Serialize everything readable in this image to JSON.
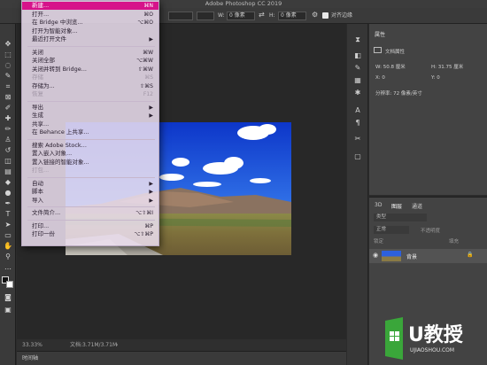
{
  "app": {
    "title": "Adobe Photoshop CC 2019"
  },
  "options_bar": {
    "w_label": "W:",
    "w_value": "0 像素",
    "h_label": "H:",
    "h_value": "0 像素",
    "align_edges_label": "对齐边缘"
  },
  "file_menu": {
    "items": [
      {
        "label": "新建...",
        "shortcut": "⌘N",
        "highlighted": true
      },
      {
        "label": "打开...",
        "shortcut": "⌘O"
      },
      {
        "label": "在 Bridge 中浏览...",
        "shortcut": "⌥⌘O"
      },
      {
        "label": "打开为智能对象..."
      },
      {
        "label": "最近打开文件",
        "submenu": true
      },
      {
        "label": "关闭",
        "shortcut": "⌘W"
      },
      {
        "label": "关闭全部",
        "shortcut": "⌥⌘W"
      },
      {
        "label": "关闭并转到 Bridge...",
        "shortcut": "⇧⌘W"
      },
      {
        "label": "存储",
        "shortcut": "⌘S",
        "disabled": true
      },
      {
        "label": "存储为...",
        "shortcut": "⇧⌘S"
      },
      {
        "label": "恢复",
        "shortcut": "F12",
        "disabled": true
      },
      {
        "label": "导出",
        "submenu": true
      },
      {
        "label": "生成",
        "submenu": true
      },
      {
        "label": "共享..."
      },
      {
        "label": "在 Behance 上共享..."
      },
      {
        "label": "搜索 Adobe Stock..."
      },
      {
        "label": "置入嵌入对象..."
      },
      {
        "label": "置入链接的智能对象..."
      },
      {
        "label": "打包...",
        "disabled": true
      },
      {
        "label": "自动",
        "submenu": true
      },
      {
        "label": "脚本",
        "submenu": true
      },
      {
        "label": "导入",
        "submenu": true
      },
      {
        "label": "文件简介...",
        "shortcut": "⌥⇧⌘I"
      },
      {
        "label": "打印...",
        "shortcut": "⌘P"
      },
      {
        "label": "打印一份",
        "shortcut": "⌥⇧⌘P"
      }
    ]
  },
  "properties_panel": {
    "tab": "属性",
    "section_title": "文档属性",
    "w_label": "W: 50.8 厘米",
    "h_label": "H: 31.75 厘米",
    "x_label": "X: 0",
    "y_label": "Y: 0",
    "resolution_label": "分辨率: 72 像素/英寸"
  },
  "layers_panel": {
    "tabs": [
      "3D",
      "图层",
      "通道"
    ],
    "kind_label": "类型",
    "mode_label": "正常",
    "opacity_label": "不透明度",
    "lock_label": "锁定",
    "fill_label": "填充",
    "layer_name": "背景"
  },
  "status_bar": {
    "zoom": "33.33%",
    "doc_info": "文档:3.71M/3.71M"
  },
  "timeline": {
    "label": "时间轴"
  },
  "watermark": {
    "brand": "U教授",
    "url": "UJIAOSHOU.COM"
  },
  "colors": {
    "highlight": "#d6138a",
    "menu_bg": "#ece0f0",
    "panel_bg": "#434343",
    "workspace_bg": "#282828"
  }
}
